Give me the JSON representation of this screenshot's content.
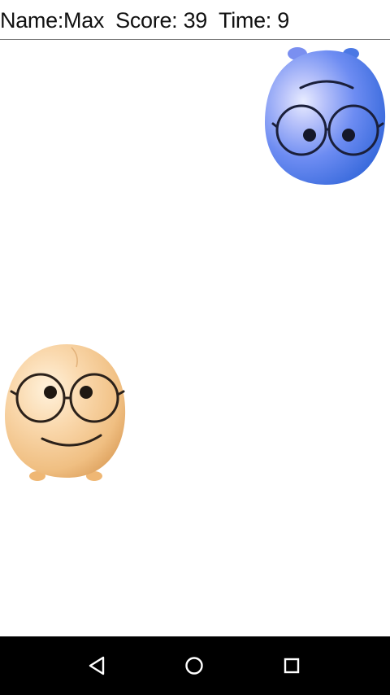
{
  "hud": {
    "name": "Name:Max",
    "score": "Score: 39",
    "time": "Time: 9"
  },
  "characters": [
    {
      "id": "blue",
      "color": "#5a7ff0",
      "expression": "frown"
    },
    {
      "id": "tan",
      "color": "#f2c58c",
      "expression": "smile"
    }
  ],
  "navbar": {
    "back_icon": "back-triangle-icon",
    "home_icon": "home-circle-icon",
    "recents_icon": "recents-square-icon",
    "icon_color": "#ffffff",
    "background": "#000000"
  }
}
